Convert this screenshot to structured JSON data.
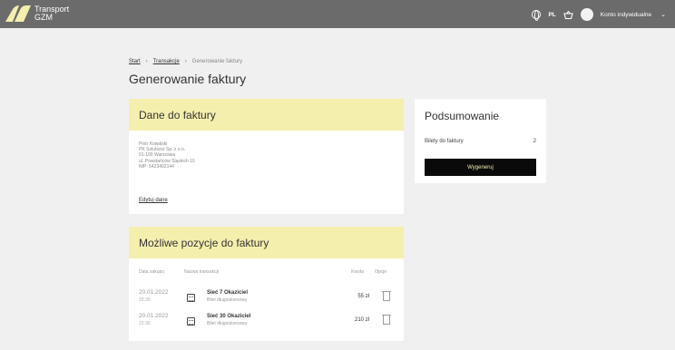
{
  "header": {
    "logo_line1": "Transport",
    "logo_line2": "GZM",
    "language": "PL",
    "account_label": "Konto indywidualne"
  },
  "breadcrumb": {
    "start": "Start",
    "transactions": "Transakcje",
    "current": "Generowanie faktury"
  },
  "page_title": "Generowanie faktury",
  "invoice_data": {
    "title": "Dane do faktury",
    "address_lines": [
      "Piotr Kowalski",
      "PK Solutions Sp. z o.o.",
      "01-100 Warszawa",
      "ul. Powstańców Śląskich 10",
      "NIP: 5423402144"
    ],
    "edit_label": "Edytuj dane"
  },
  "positions": {
    "title": "Możliwe pozycje do faktury",
    "columns": [
      "Data zakupu",
      "Nazwa transakcji",
      "Kwota",
      "Opcje"
    ],
    "rows": [
      {
        "date": "20.01.2022",
        "time": "15:30",
        "name": "Sieć 7 Okaziciel",
        "type": "Bilet długookresowy",
        "amount": "55 zł"
      },
      {
        "date": "20.01.2022",
        "time": "15:30",
        "name": "Sieć 30 Okaziciel",
        "type": "Bilet długookresowy",
        "amount": "210 zł"
      }
    ]
  },
  "summary": {
    "title": "Podsumowanie",
    "tickets_label": "Bilety do faktury",
    "tickets_count": "2",
    "generate_label": "Wygeneruj"
  },
  "colors": {
    "topbar": "#6b6b6b",
    "accent_yellow": "#f5efae",
    "button_black": "#0a0a0a"
  }
}
